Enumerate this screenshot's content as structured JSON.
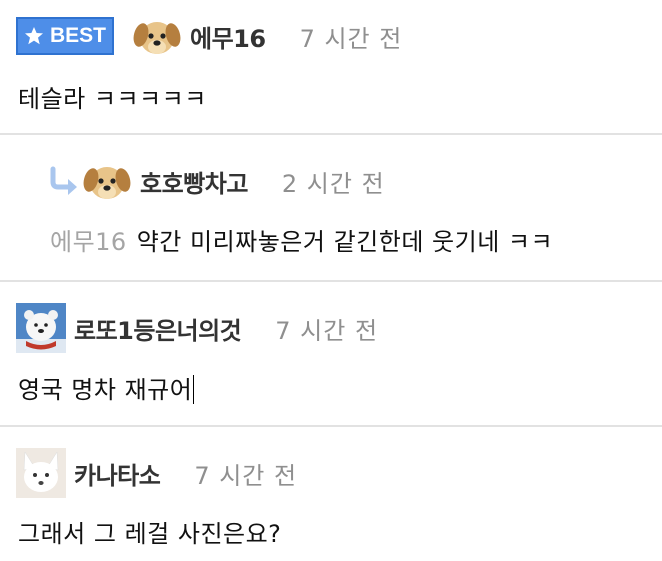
{
  "comments": [
    {
      "badge": "BEST",
      "nickname": "에무16",
      "time": "7 시간 전",
      "text": "테슬라 ㅋㅋㅋㅋㅋ",
      "avatar": "puppy-avatar"
    },
    {
      "nickname": "호호빵차고",
      "time": "2 시간 전",
      "mention": "에무16",
      "text": "약간 미리짜놓은거 같긴한데 웃기네 ㅋㅋ",
      "avatar": "puppy-avatar",
      "is_reply": true
    },
    {
      "nickname": "로또1등은너의것",
      "time": "7 시간 전",
      "text": "영국 명차 재규어",
      "avatar": "polar-bear-avatar"
    },
    {
      "nickname": "카나타소",
      "time": "7 시간 전",
      "text": "그래서 그 레걸 사진은요?",
      "avatar": "arctic-fox-avatar"
    }
  ],
  "colors": {
    "badge_bg": "#4e8ee8",
    "divider": "#e2e2e2",
    "time": "#8f8f8f",
    "mention": "#a5a5a5"
  }
}
